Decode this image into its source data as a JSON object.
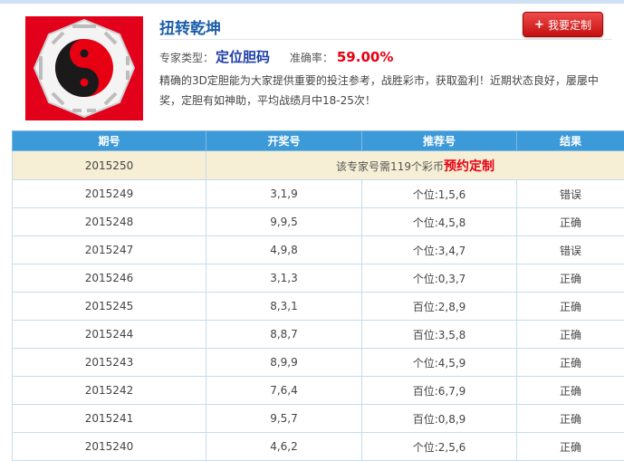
{
  "header": {
    "title": "扭转乾坤",
    "button_plus": "+",
    "button_label": "我要定制",
    "type_label": "专家类型：",
    "type_value": "定位胆码",
    "accuracy_label": "准确率：",
    "accuracy_value": "59.00%",
    "description": "精确的3D定胆能为大家提供重要的投注参考，战胜彩市，获取盈利！近期状态良好，屡屡中奖，定胆有如神助，平均战绩月中18-25次！"
  },
  "colors": {
    "title": "#1c5ea8",
    "header_row": "#3d9ad8",
    "accent_red": "#e60012",
    "notice_bg": "#f6efd5",
    "logo_bg": "#e3001b"
  },
  "logo_icon": "bagua-yinyang-icon",
  "table": {
    "headers": [
      "期号",
      "开奖号",
      "推荐号",
      "结果"
    ],
    "notice": {
      "period": "2015250",
      "text": "该专家号需119个彩币",
      "strong": "预约定制"
    },
    "rows": [
      {
        "period": "2015249",
        "draw": "3,1,9",
        "rec": "个位:1,5,6",
        "result": "错误"
      },
      {
        "period": "2015248",
        "draw": "9,9,5",
        "rec": "个位:4,5,8",
        "result": "正确"
      },
      {
        "period": "2015247",
        "draw": "4,9,8",
        "rec": "个位:3,4,7",
        "result": "错误"
      },
      {
        "period": "2015246",
        "draw": "3,1,3",
        "rec": "个位:0,3,7",
        "result": "正确"
      },
      {
        "period": "2015245",
        "draw": "8,3,1",
        "rec": "百位:2,8,9",
        "result": "正确"
      },
      {
        "period": "2015244",
        "draw": "8,8,7",
        "rec": "百位:3,5,8",
        "result": "正确"
      },
      {
        "period": "2015243",
        "draw": "8,9,9",
        "rec": "个位:4,5,9",
        "result": "正确"
      },
      {
        "period": "2015242",
        "draw": "7,6,4",
        "rec": "百位:6,7,9",
        "result": "正确"
      },
      {
        "period": "2015241",
        "draw": "9,5,7",
        "rec": "百位:0,8,9",
        "result": "正确"
      },
      {
        "period": "2015240",
        "draw": "4,6,2",
        "rec": "个位:2,5,6",
        "result": "正确"
      }
    ]
  }
}
